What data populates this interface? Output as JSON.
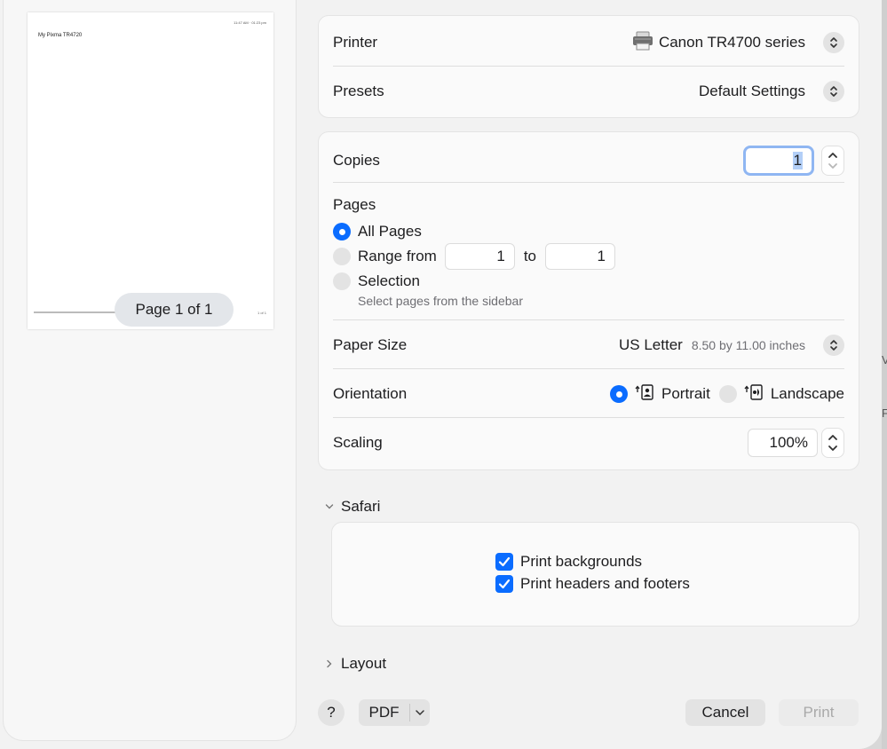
{
  "preview": {
    "page_header": "11:47 AM · 01:23 pm",
    "page_title": "My Pixma TR4720",
    "page_footer": "1 of 1",
    "page_indicator": "Page 1 of 1"
  },
  "printer": {
    "label": "Printer",
    "value": "Canon TR4700 series"
  },
  "presets": {
    "label": "Presets",
    "value": "Default Settings"
  },
  "copies": {
    "label": "Copies",
    "value": "1"
  },
  "pages": {
    "label": "Pages",
    "options": [
      {
        "label": "All Pages",
        "selected": true
      },
      {
        "label": "Range from",
        "selected": false
      },
      {
        "label": "Selection",
        "selected": false
      }
    ],
    "range_from": "1",
    "range_to_label": "to",
    "range_to": "1",
    "selection_hint": "Select pages from the sidebar"
  },
  "paper_size": {
    "label": "Paper Size",
    "value": "US Letter",
    "detail": "8.50 by 11.00 inches"
  },
  "orientation": {
    "label": "Orientation",
    "options": [
      {
        "label": "Portrait",
        "selected": true
      },
      {
        "label": "Landscape",
        "selected": false
      }
    ]
  },
  "scaling": {
    "label": "Scaling",
    "value": "100%"
  },
  "safari": {
    "label": "Safari",
    "options": [
      {
        "label": "Print backgrounds",
        "checked": true
      },
      {
        "label": "Print headers and footers",
        "checked": true
      }
    ]
  },
  "layout": {
    "label": "Layout"
  },
  "buttons": {
    "help": "?",
    "pdf": "PDF",
    "cancel": "Cancel",
    "print": "Print"
  },
  "colors": {
    "accent": "#0a6cff",
    "focus_ring": "#8fb6f2"
  }
}
